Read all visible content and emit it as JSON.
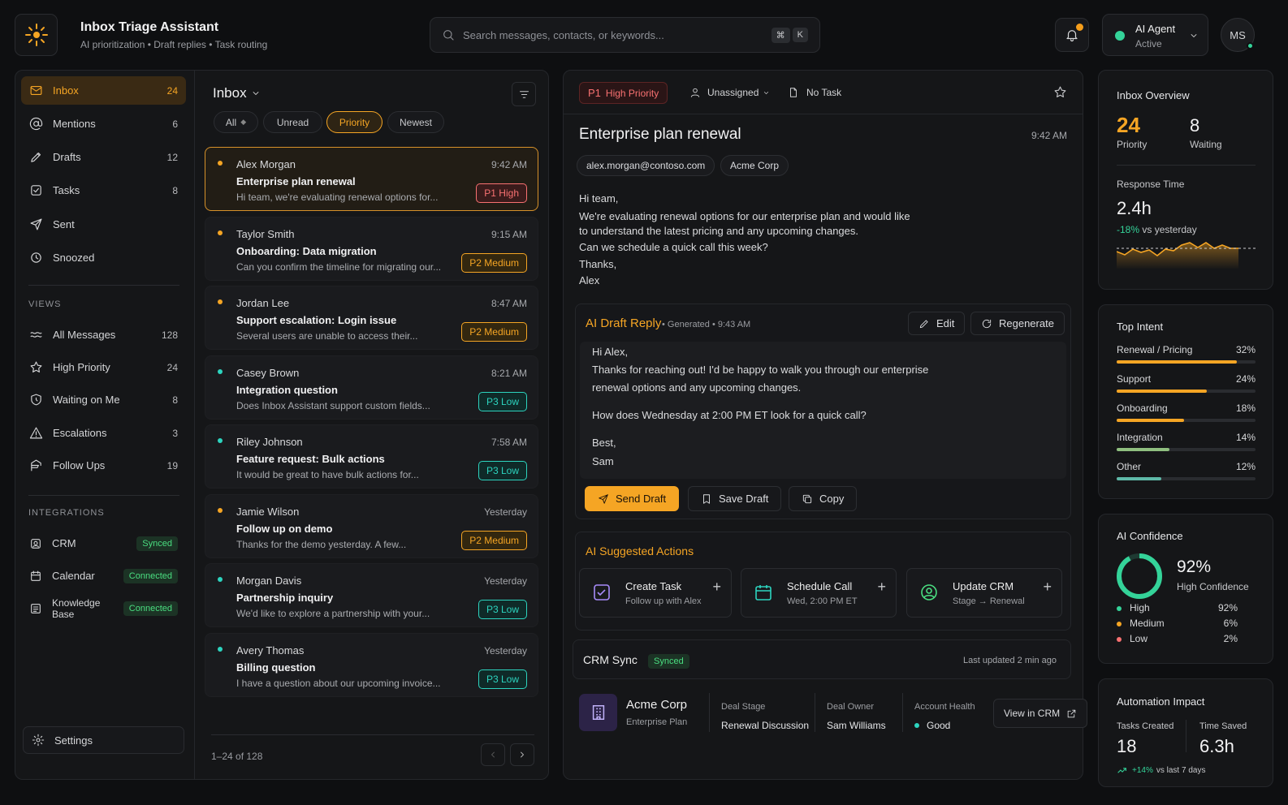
{
  "header": {
    "title": "Inbox Triage Assistant",
    "subtitle": "AI prioritization • Draft replies • Task routing",
    "search_placeholder": "Search messages, contacts, or keywords...",
    "shortcut_mod": "⌘",
    "shortcut_key": "K",
    "agent_name": "AI Agent",
    "agent_status": "Active",
    "avatar_initials": "MS"
  },
  "sidebar": {
    "main": [
      {
        "label": "Inbox",
        "count": "24",
        "icon": "mail-icon"
      },
      {
        "label": "Mentions",
        "count": "6",
        "icon": "at-icon"
      },
      {
        "label": "Drafts",
        "count": "12",
        "icon": "pencil-icon"
      },
      {
        "label": "Tasks",
        "count": "8",
        "icon": "check-square-icon"
      },
      {
        "label": "Sent",
        "count": "",
        "icon": "send-icon"
      },
      {
        "label": "Snoozed",
        "count": "",
        "icon": "clock-icon"
      }
    ],
    "views_title": "VIEWS",
    "views": [
      {
        "label": "All Messages",
        "count": "128",
        "icon": "waves-icon"
      },
      {
        "label": "High Priority",
        "count": "24",
        "icon": "star-icon"
      },
      {
        "label": "Waiting on Me",
        "count": "8",
        "icon": "shield-clock-icon"
      },
      {
        "label": "Escalations",
        "count": "3",
        "icon": "alert-triangle-icon"
      },
      {
        "label": "Follow Ups",
        "count": "19",
        "icon": "flag-icon"
      }
    ],
    "integrations_title": "INTEGRATIONS",
    "integrations": [
      {
        "label": "CRM",
        "status": "Synced"
      },
      {
        "label": "Calendar",
        "status": "Connected"
      },
      {
        "label": "Knowledge Base",
        "status": "Connected"
      }
    ],
    "settings": "Settings"
  },
  "inbox": {
    "title": "Inbox",
    "filters": [
      "All",
      "Unread",
      "Priority",
      "Newest"
    ],
    "pagination": "1–24 of 128",
    "messages": [
      {
        "from": "Alex Morgan",
        "time": "9:42 AM",
        "subject": "Enterprise plan renewal",
        "preview": "Hi team, we're evaluating renewal options for...",
        "badge": "P1  High",
        "level": "high"
      },
      {
        "from": "Taylor Smith",
        "time": "9:15 AM",
        "subject": "Onboarding: Data migration",
        "preview": "Can you confirm the timeline for migrating our...",
        "badge": "P2  Medium",
        "level": "med"
      },
      {
        "from": "Jordan Lee",
        "time": "8:47 AM",
        "subject": "Support escalation: Login issue",
        "preview": "Several users are unable to access their...",
        "badge": "P2  Medium",
        "level": "med"
      },
      {
        "from": "Casey Brown",
        "time": "8:21 AM",
        "subject": "Integration question",
        "preview": "Does Inbox Assistant support custom fields...",
        "badge": "P3  Low",
        "level": "low"
      },
      {
        "from": "Riley Johnson",
        "time": "7:58 AM",
        "subject": "Feature request: Bulk actions",
        "preview": "It would be great to have bulk actions for...",
        "badge": "P3  Low",
        "level": "low"
      },
      {
        "from": "Jamie Wilson",
        "time": "Yesterday",
        "subject": "Follow up on demo",
        "preview": "Thanks for the demo yesterday. A few...",
        "badge": "P2  Medium",
        "level": "med"
      },
      {
        "from": "Morgan Davis",
        "time": "Yesterday",
        "subject": "Partnership inquiry",
        "preview": "We'd like to explore a partnership with your...",
        "badge": "P3  Low",
        "level": "low"
      },
      {
        "from": "Avery Thomas",
        "time": "Yesterday",
        "subject": "Billing question",
        "preview": "I have a question about our upcoming invoice...",
        "badge": "P3  Low",
        "level": "low"
      }
    ]
  },
  "detail": {
    "priority_prefix": "P1",
    "priority_label": "High Priority",
    "assignee": "Unassigned",
    "task": "No Task",
    "subject": "Enterprise plan renewal",
    "time": "9:42 AM",
    "email": "alex.morgan@contoso.com",
    "company": "Acme Corp",
    "body": [
      "Hi team,",
      "We're evaluating renewal options for our enterprise plan and would like",
      "to understand the latest pricing and any upcoming changes.",
      "Can we schedule a quick call this week?",
      "Thanks,",
      "Alex"
    ],
    "draft": {
      "title": "AI Draft Reply",
      "meta": "• Generated • 9:43 AM",
      "edit": "Edit",
      "regenerate": "Regenerate",
      "lines": [
        "Hi Alex,",
        "Thanks for reaching out! I'd be happy to walk you through our enterprise",
        "renewal options and any upcoming changes.",
        "How does Wednesday at 2:00 PM ET look for a quick call?",
        "Best,",
        "Sam"
      ],
      "send": "Send Draft",
      "save": "Save Draft",
      "copy": "Copy"
    },
    "actions_title": "AI Suggested Actions",
    "actions": [
      {
        "title": "Create Task",
        "sub": "Follow up with Alex"
      },
      {
        "title": "Schedule Call",
        "sub": "Wed, 2:00 PM ET"
      },
      {
        "title": "Update CRM",
        "sub": "Stage → Renewal"
      }
    ],
    "crm": {
      "title": "CRM Sync",
      "status": "Synced",
      "updated": "Last updated 2 min ago",
      "company": "Acme Corp",
      "plan": "Enterprise Plan",
      "stage_label": "Deal Stage",
      "stage": "Renewal Discussion",
      "owner_label": "Deal Owner",
      "owner": "Sam Williams",
      "health_label": "Account Health",
      "health": "Good",
      "view": "View in CRM"
    }
  },
  "overview": {
    "title": "Inbox Overview",
    "priority_value": "24",
    "priority_label": "Priority",
    "waiting_value": "8",
    "waiting_label": "Waiting",
    "response_label": "Response Time",
    "response_value": "2.4h",
    "response_change": "-18%",
    "response_suffix": "vs yesterday"
  },
  "intent": {
    "title": "Top Intent",
    "items": [
      {
        "label": "Renewal / Pricing",
        "pct": "32%",
        "value": 0.32,
        "color": "#f5a524"
      },
      {
        "label": "Support",
        "pct": "24%",
        "value": 0.24,
        "color": "#f5a524"
      },
      {
        "label": "Onboarding",
        "pct": "18%",
        "value": 0.18,
        "color": "#f5a524"
      },
      {
        "label": "Integration",
        "pct": "14%",
        "value": 0.14,
        "color": "#8fbf7f"
      },
      {
        "label": "Other",
        "pct": "12%",
        "value": 0.12,
        "color": "#5fb9a8"
      }
    ]
  },
  "confidence": {
    "title": "AI Confidence",
    "value": "92%",
    "fraction": 0.92,
    "label": "High Confidence",
    "rows": [
      {
        "label": "High",
        "pct": "92%",
        "color": "#34d399"
      },
      {
        "label": "Medium",
        "pct": "6%",
        "color": "#f5a524"
      },
      {
        "label": "Low",
        "pct": "2%",
        "color": "#f87171"
      }
    ]
  },
  "automation": {
    "title": "Automation Impact",
    "tasks_label": "Tasks Created",
    "tasks_value": "18",
    "time_label": "Time Saved",
    "time_value": "6.3h",
    "change": "+14%",
    "change_suffix": "vs last 7 days"
  },
  "colors": {
    "accent": "#f5a524",
    "success": "#34d399",
    "danger": "#f87171",
    "teal": "#2dd4bf"
  }
}
